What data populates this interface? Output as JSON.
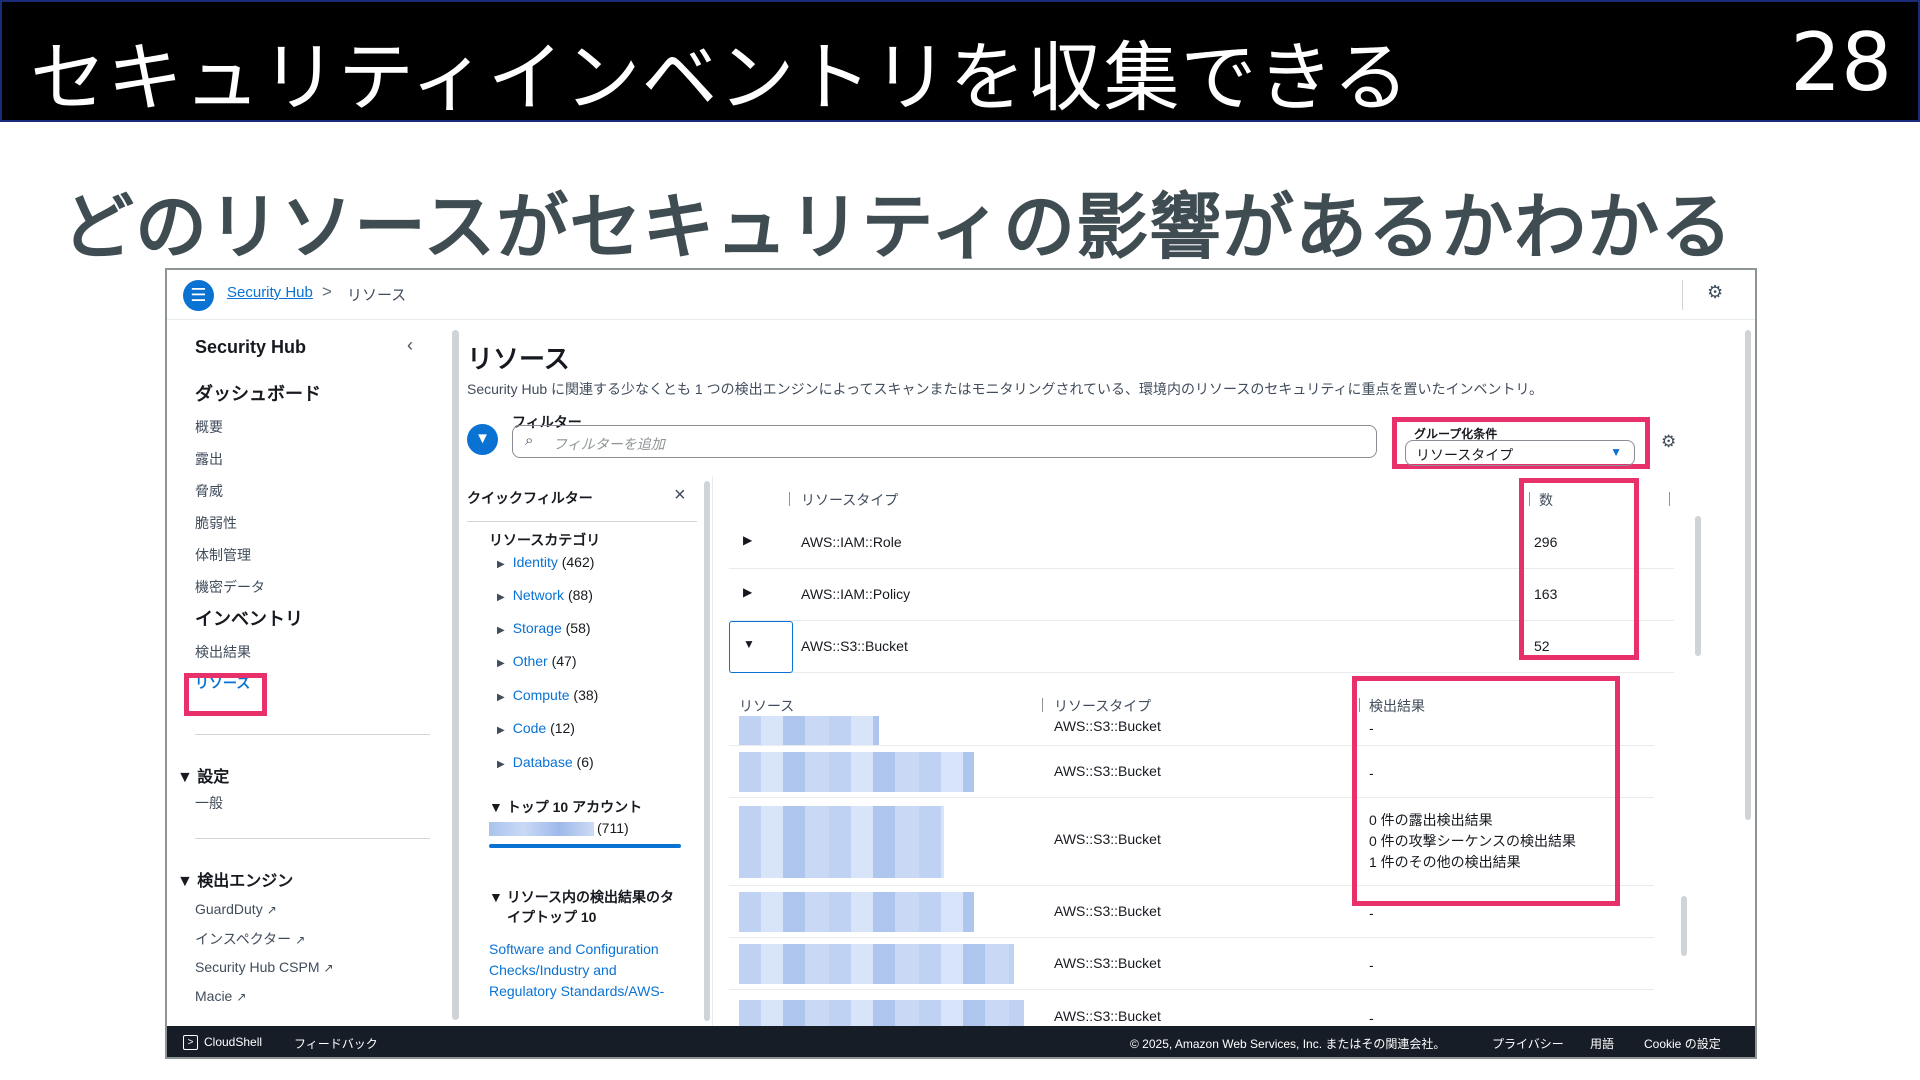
{
  "slide": {
    "title": "セキュリティインベントリを収集できる",
    "number": "28",
    "subtitle": "どのリソースがセキュリティの影響があるかわかる"
  },
  "topbar": {
    "breadcrumb_link": "Security Hub",
    "breadcrumb_sep": ">",
    "breadcrumb_current": "リソース"
  },
  "sidenav": {
    "header": "Security Hub",
    "sections": {
      "dashboard": "ダッシュボード",
      "inventory": "インベントリ"
    },
    "dashboard_items": [
      "概要",
      "露出",
      "脅威",
      "脆弱性",
      "体制管理",
      "機密データ"
    ],
    "inventory_items": [
      "検出結果",
      "リソース"
    ],
    "settings_group": "▼ 設定",
    "settings_items": [
      "一般"
    ],
    "engines_group": "▼ 検出エンジン",
    "engine_items": [
      "GuardDuty",
      "インスペクター",
      "Security Hub CSPM",
      "Macie"
    ]
  },
  "main": {
    "title": "リソース",
    "description": "Security Hub に関連する少なくとも 1 つの検出エンジンによってスキャンまたはモニタリングされている、環境内のリソースのセキュリティに重点を置いたインベントリ。",
    "filter_label": "フィルター",
    "search_placeholder": "フィルターを追加",
    "group_label": "グループ化条件",
    "group_value": "リソースタイプ"
  },
  "quick_filter": {
    "title": "クイックフィルター",
    "category_title": "リソースカテゴリ",
    "categories": [
      {
        "name": "Identity",
        "count": "(462)"
      },
      {
        "name": "Network",
        "count": "(88)"
      },
      {
        "name": "Storage",
        "count": "(58)"
      },
      {
        "name": "Other",
        "count": "(47)"
      },
      {
        "name": "Compute",
        "count": "(38)"
      },
      {
        "name": "Code",
        "count": "(12)"
      },
      {
        "name": "Database",
        "count": "(6)"
      }
    ],
    "top_accounts_title": "▼ トップ 10 アカウント",
    "account_count": "(711)",
    "top_findings_title_1": "▼ リソース内の検出結果のタ",
    "top_findings_title_2": "イプトップ 10",
    "finding_links": [
      "Software and Configuration",
      "Checks/Industry and",
      "Regulatory Standards/AWS-"
    ]
  },
  "table": {
    "col_resource_type": "リソースタイプ",
    "col_count": "数",
    "rows": [
      {
        "type": "AWS::IAM::Role",
        "count": "296",
        "expander": "▶"
      },
      {
        "type": "AWS::IAM::Policy",
        "count": "163",
        "expander": "▶"
      },
      {
        "type": "AWS::S3::Bucket",
        "count": "52",
        "expander": "▼"
      }
    ],
    "sub_col_resource": "リソース",
    "sub_col_type": "リソースタイプ",
    "sub_col_findings": "検出結果",
    "sub_rows": [
      {
        "type": "AWS::S3::Bucket",
        "findings": [
          "-"
        ]
      },
      {
        "type": "AWS::S3::Bucket",
        "findings": [
          "-"
        ]
      },
      {
        "type": "AWS::S3::Bucket",
        "findings": [
          "0 件の露出検出結果",
          "0 件の攻撃シーケンスの検出結果",
          "1 件のその他の検出結果"
        ]
      },
      {
        "type": "AWS::S3::Bucket",
        "findings": [
          "-"
        ]
      },
      {
        "type": "AWS::S3::Bucket",
        "findings": [
          "-"
        ]
      },
      {
        "type": "AWS::S3::Bucket",
        "findings": [
          "-"
        ]
      }
    ]
  },
  "bottombar": {
    "cloudshell": "CloudShell",
    "feedback": "フィードバック",
    "copyright": "© 2025, Amazon Web Services, Inc. またはその関連会社。",
    "privacy": "プライバシー",
    "terms": "用語",
    "cookie": "Cookie の設定"
  },
  "colors": {
    "highlight": "#e8316b",
    "link": "#0972d3",
    "slide_header_bg": "#000000",
    "subtitle": "#3f4d52"
  }
}
